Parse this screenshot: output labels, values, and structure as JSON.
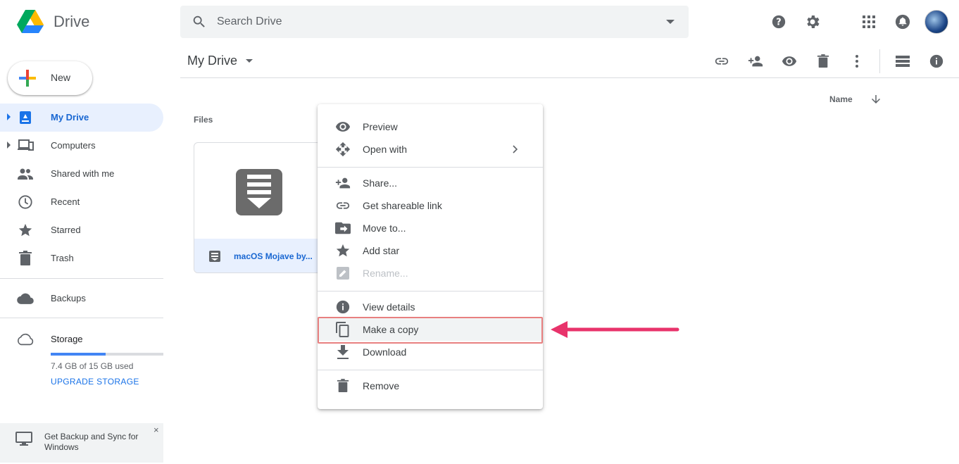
{
  "app": {
    "name": "Drive"
  },
  "search": {
    "placeholder": "Search Drive"
  },
  "sidebar": {
    "new_label": "New",
    "items": [
      {
        "label": "My Drive",
        "icon": "my-drive-icon",
        "active": true
      },
      {
        "label": "Computers",
        "icon": "computers-icon"
      },
      {
        "label": "Shared with me",
        "icon": "shared-icon"
      },
      {
        "label": "Recent",
        "icon": "clock-icon"
      },
      {
        "label": "Starred",
        "icon": "star-icon"
      },
      {
        "label": "Trash",
        "icon": "trash-icon"
      },
      {
        "label": "Backups",
        "icon": "cloud-icon"
      },
      {
        "label": "Storage",
        "icon": "cloud-outline-icon"
      }
    ],
    "storage": {
      "used_text": "7.4 GB of 15 GB used",
      "used_fraction": 0.49,
      "upgrade_label": "UPGRADE STORAGE"
    },
    "banner": {
      "text": "Get Backup and Sync for Windows",
      "close": "×"
    }
  },
  "main": {
    "title": "My Drive",
    "sort_label": "Name",
    "files_label": "Files",
    "file": {
      "name": "macOS Mojave by..."
    }
  },
  "context_menu": {
    "items": [
      {
        "label": "Preview",
        "icon": "eye-icon"
      },
      {
        "label": "Open with",
        "icon": "move-arrows-icon",
        "submenu": true
      },
      {
        "label": "Share...",
        "icon": "person-add-icon"
      },
      {
        "label": "Get shareable link",
        "icon": "link-icon"
      },
      {
        "label": "Move to...",
        "icon": "folder-move-icon"
      },
      {
        "label": "Add star",
        "icon": "star-icon"
      },
      {
        "label": "Rename...",
        "icon": "rename-icon",
        "disabled": true
      },
      {
        "label": "View details",
        "icon": "info-icon"
      },
      {
        "label": "Make a copy",
        "icon": "copy-icon",
        "highlighted": true
      },
      {
        "label": "Download",
        "icon": "download-icon"
      },
      {
        "label": "Remove",
        "icon": "trash-icon"
      }
    ]
  },
  "colors": {
    "accent": "#1a73e8",
    "active_bg": "#e8f0fe",
    "annotation_arrow": "#e8336b",
    "annotation_box": "#e88080"
  }
}
